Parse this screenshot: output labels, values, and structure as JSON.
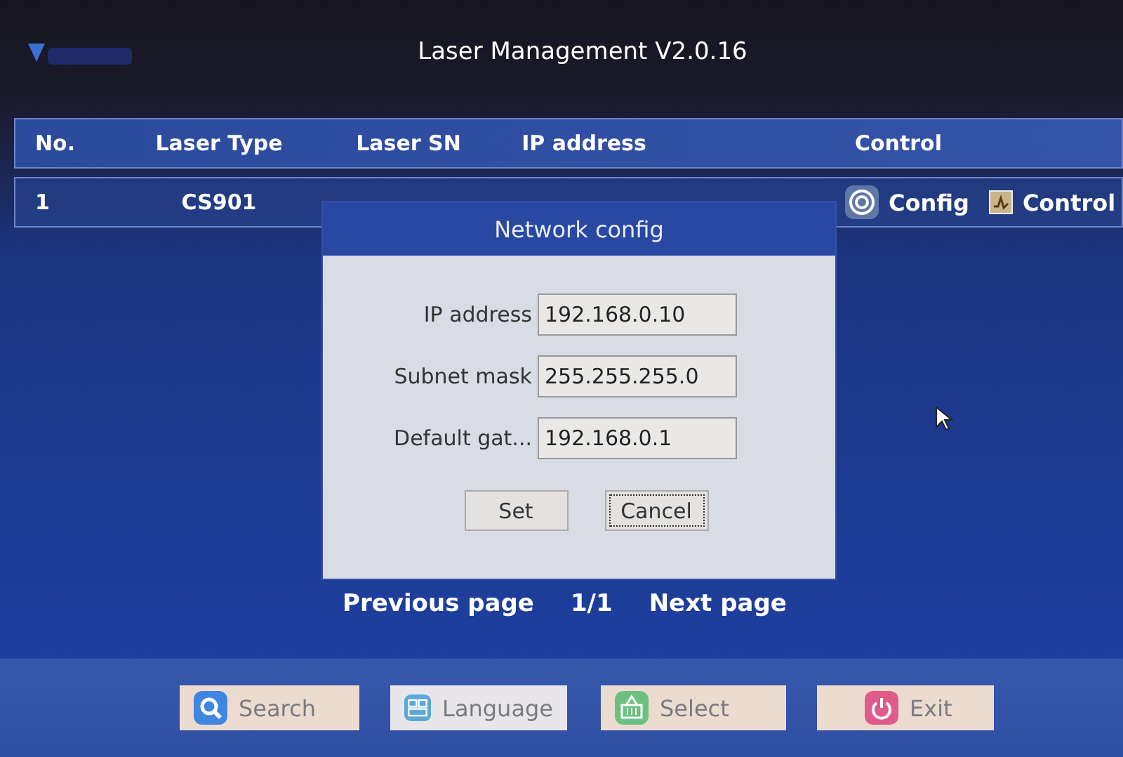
{
  "window": {
    "title": "Laser Management V2.0.16"
  },
  "table": {
    "columns": [
      "No.",
      "Laser Type",
      "Laser SN",
      "IP address",
      "Control"
    ],
    "rows": [
      {
        "no": "1",
        "laser_type": "CS901",
        "actions": [
          {
            "kind": "config",
            "label": "Config"
          },
          {
            "kind": "control",
            "label": "Control"
          }
        ]
      }
    ]
  },
  "dialog": {
    "title": "Network config",
    "fields": [
      {
        "label": "IP address",
        "value": "192.168.0.10"
      },
      {
        "label": "Subnet mask",
        "value": "255.255.255.0"
      },
      {
        "label": "Default gat...",
        "value": "192.168.0.1"
      }
    ],
    "buttons": [
      {
        "label": "Set",
        "focused": false
      },
      {
        "label": "Cancel",
        "focused": true
      }
    ]
  },
  "pagination": {
    "previous": "Previous page",
    "page": "1/1",
    "next": "Next page"
  },
  "toolbar": [
    {
      "kind": "search",
      "label": "Search"
    },
    {
      "kind": "language",
      "label": "Language"
    },
    {
      "kind": "select",
      "label": "Select"
    },
    {
      "kind": "exit",
      "label": "Exit"
    }
  ]
}
